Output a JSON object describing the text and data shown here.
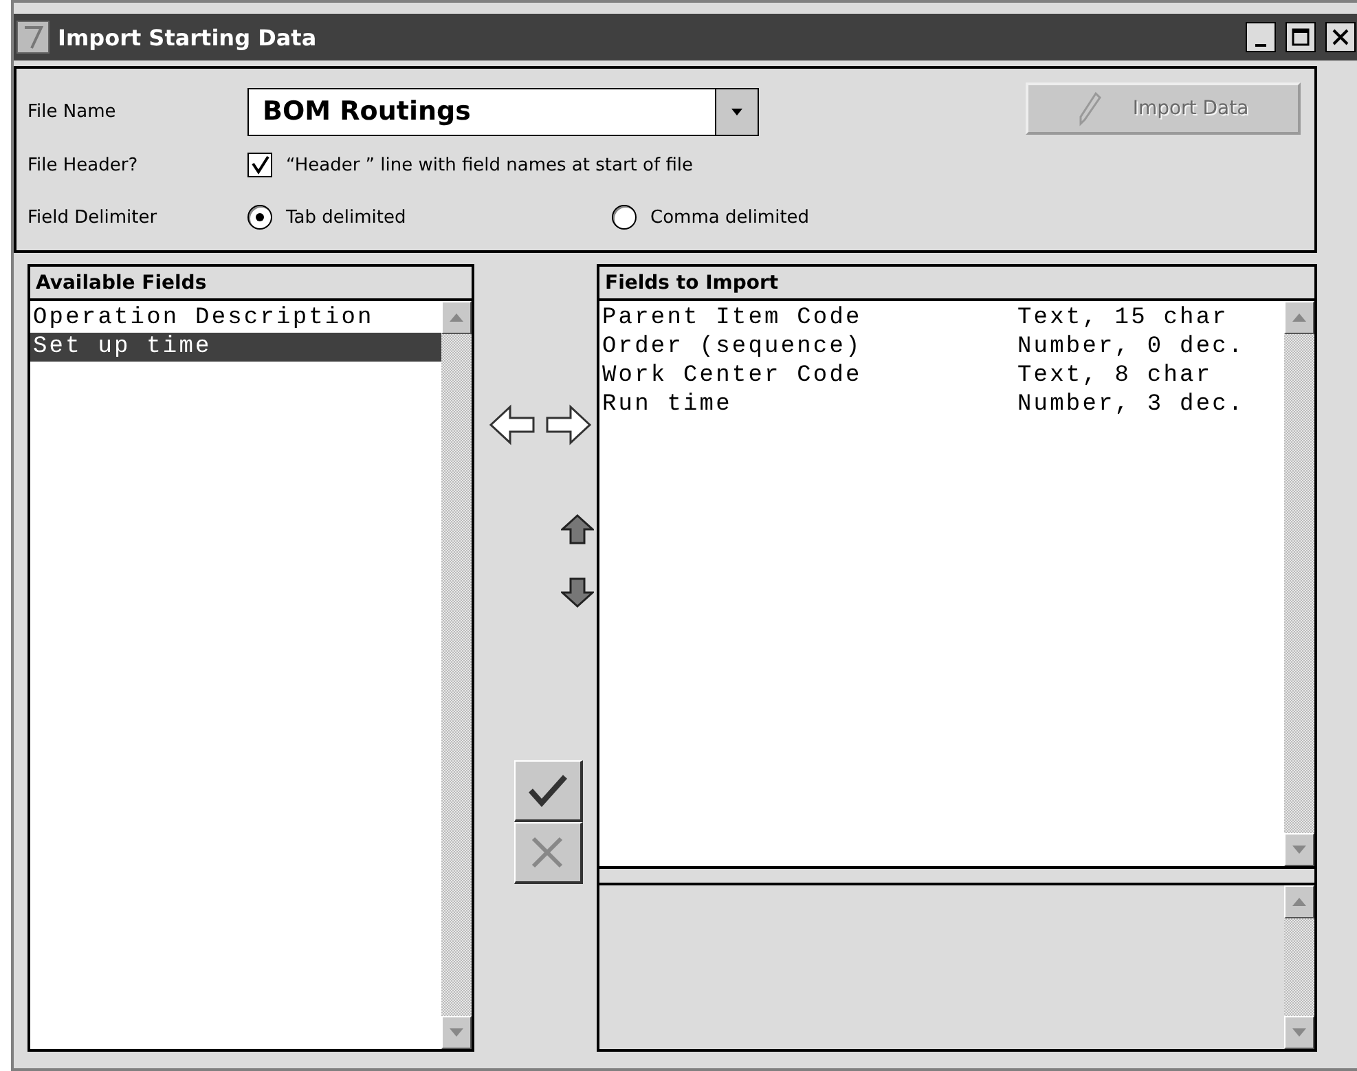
{
  "window": {
    "title": "Import Starting Data"
  },
  "file_name": {
    "label": "File Name",
    "value": "BOM Routings"
  },
  "import_button": {
    "label": "Import Data",
    "disabled": true
  },
  "file_header": {
    "label": "File Header?",
    "text": "“Header ” line with field names at start of file",
    "checked": true
  },
  "field_delimiter": {
    "label": "Field Delimiter",
    "options": [
      {
        "label": "Tab delimited",
        "selected": true
      },
      {
        "label": "Comma delimited",
        "selected": false
      }
    ]
  },
  "available_fields": {
    "title": "Available Fields",
    "items": [
      {
        "name": "Operation Description",
        "selected": false
      },
      {
        "name": "Set up time",
        "selected": true
      }
    ]
  },
  "fields_to_import": {
    "title": "Fields to Import",
    "items": [
      {
        "name": "Parent Item Code",
        "type": "Text, 15 char",
        "selected": false
      },
      {
        "name": "Order (sequence)",
        "type": "Number, 0 dec.",
        "selected": false
      },
      {
        "name": "Work Center Code",
        "type": "Text, 8 char",
        "selected": false
      },
      {
        "name": "Run time",
        "type": "Number, 3 dec.",
        "selected": false
      }
    ]
  }
}
